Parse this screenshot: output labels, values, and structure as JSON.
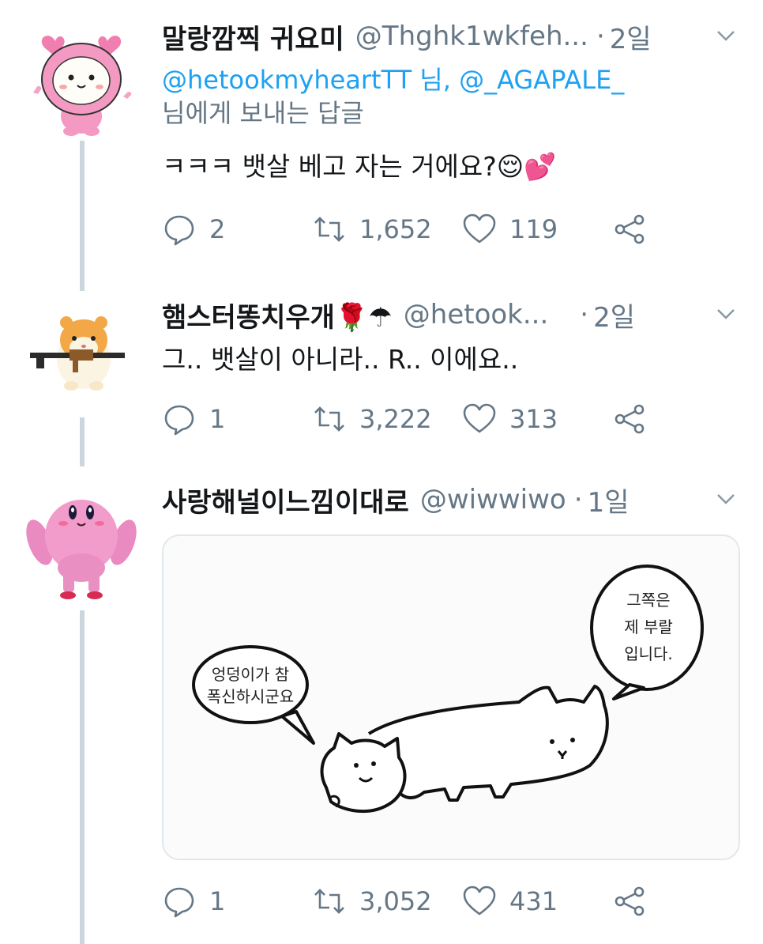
{
  "tweets": [
    {
      "display_name": "말랑깜찍 귀요미",
      "handle": "@Thghk1wkfeh...",
      "separator": "·",
      "time": "2일",
      "reply_mentions": "@hetookmyheartTT 님, @_AGAPALE_",
      "reply_suffix": "님에게 보내는 답글",
      "text": "ㅋㅋㅋ 뱃살 베고 자는 거에요?😌💕",
      "replies": "2",
      "retweets": "1,652",
      "likes": "119",
      "avatar_icon": "pink-hat-character-avatar"
    },
    {
      "display_name": "햄스터똥치우개🌹☂",
      "handle": "@hetook...",
      "separator": "·",
      "time": "2일",
      "text": "그.. 뱃살이 아니라.. R.. 이에요..",
      "replies": "1",
      "retweets": "3,222",
      "likes": "313",
      "avatar_icon": "hamster-with-rifle-avatar"
    },
    {
      "display_name": "사랑해널이느낌이대로",
      "handle": "@wiwwiwo",
      "separator": "·",
      "time": "1일",
      "replies": "1",
      "retweets": "3,052",
      "likes": "431",
      "avatar_icon": "muscular-kirby-avatar",
      "media": {
        "bubble_left": [
          "엉덩이가 참",
          "폭신하시군요"
        ],
        "bubble_right": [
          "그쪽은",
          "제 부랄",
          "입니다."
        ]
      }
    }
  ],
  "colors": {
    "link": "#1da1f2",
    "muted": "#657786",
    "thread_line": "#ccd6dd",
    "text": "#14171a"
  }
}
